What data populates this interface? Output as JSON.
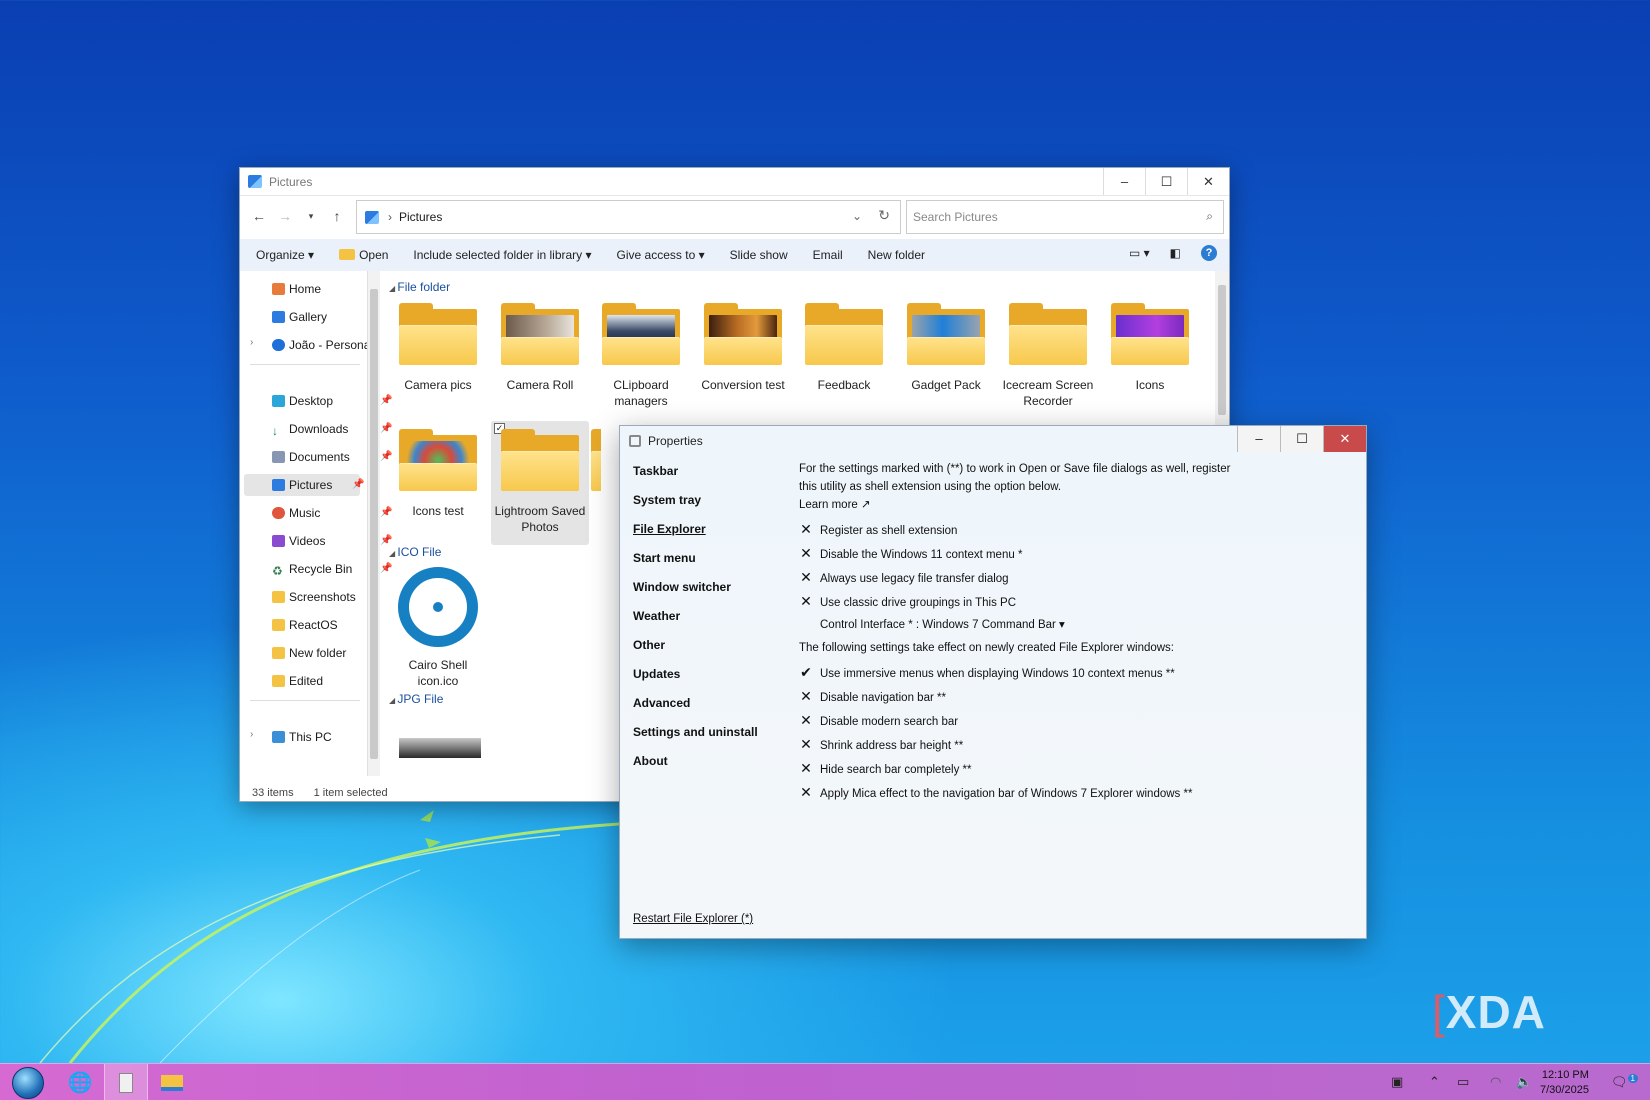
{
  "explorer": {
    "title": "Pictures",
    "address_segment": "Pictures",
    "search_placeholder": "Search Pictures",
    "toolbar": [
      "Organize",
      "Open",
      "Include selected folder in library",
      "Give access to",
      "Slide show",
      "Email",
      "New folder"
    ],
    "sidebar": {
      "home": "Home",
      "gallery": "Gallery",
      "onedrive": "João - Personal",
      "desktop": "Desktop",
      "downloads": "Downloads",
      "documents": "Documents",
      "pictures": "Pictures",
      "music": "Music",
      "videos": "Videos",
      "recycle": "Recycle Bin",
      "screenshots": "Screenshots",
      "reactos": "ReactOS",
      "new_folder": "New folder",
      "edited": "Edited",
      "this_pc": "This PC"
    },
    "groups": {
      "folders": "File folder",
      "ico": "ICO File",
      "jpg": "JPG File"
    },
    "folders": [
      "Camera pics",
      "Camera Roll",
      "CLipboard managers",
      "Conversion test",
      "Feedback",
      "Gadget Pack",
      "Icecream Screen Recorder",
      "Icons",
      "Icons test",
      "Lightroom Saved Photos"
    ],
    "ico_file": "Cairo Shell icon.ico",
    "status": {
      "items": "33 items",
      "selected": "1 item selected"
    }
  },
  "properties": {
    "title": "Properties",
    "nav": [
      "Taskbar",
      "System tray",
      "File Explorer",
      "Start menu",
      "Window switcher",
      "Weather",
      "Other",
      "Updates",
      "Advanced",
      "Settings and uninstall",
      "About"
    ],
    "active_nav": "File Explorer",
    "intro_line1": "For the settings marked with (**) to work in Open or Save file dialogs as well, register",
    "intro_line2": "this utility as shell extension using the option below.",
    "learn_more": "Learn more ↗",
    "options_a": [
      {
        "mark": "✕",
        "label": "Register as shell extension"
      },
      {
        "mark": "✕",
        "label": "Disable the Windows 11 context menu *"
      },
      {
        "mark": "✕",
        "label": "Always use legacy file transfer dialog"
      },
      {
        "mark": "✕",
        "label": "Use classic drive groupings in This PC"
      }
    ],
    "control_interface": "Control Interface * : Windows 7 Command Bar ▾",
    "note": "The following settings take effect on newly created File Explorer windows:",
    "options_b": [
      {
        "mark": "✔",
        "label": "Use immersive menus when displaying Windows 10 context menus **"
      },
      {
        "mark": "✕",
        "label": "Disable navigation bar **"
      },
      {
        "mark": "✕",
        "label": "Disable modern search bar"
      },
      {
        "mark": "✕",
        "label": "Shrink address bar height **"
      },
      {
        "mark": "✕",
        "label": "Hide search bar completely **"
      },
      {
        "mark": "✕",
        "label": "Apply Mica effect to the navigation bar of Windows 7 Explorer windows **"
      }
    ],
    "restart": "Restart File Explorer (*)"
  },
  "taskbar": {
    "time": "12:10 PM",
    "date": "7/30/2025",
    "notif_count": "1"
  },
  "watermark": "XDA",
  "colors": {
    "taskbar": "#c061cf",
    "accent": "#2b7cd3",
    "folder": "#f7c84c"
  }
}
